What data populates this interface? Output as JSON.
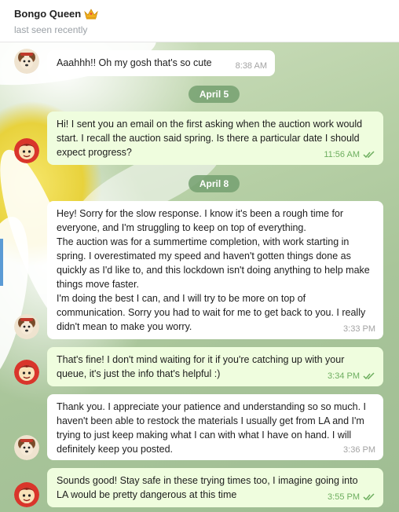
{
  "header": {
    "title": "Bongo Queen",
    "title_icon": "crown-emoji-icon",
    "status": "last seen recently"
  },
  "colors": {
    "incoming_bubble": "#ffffff",
    "outgoing_bubble": "#effdde",
    "date_pill": "#74a070",
    "read_check": "#6dae5f"
  },
  "dates": [
    "April 5",
    "April 8"
  ],
  "messages": [
    {
      "direction": "in",
      "avatar": "dog-avatar-icon",
      "text": "Aaahhh!! Oh my gosh that's so cute",
      "time": "8:38 AM",
      "read": false
    },
    {
      "direction": "out",
      "avatar": "red-character-avatar-icon",
      "text": "Hi! I sent you an email on the first asking when the auction work would start. I recall the auction said spring. Is there a particular date I should expect progress?",
      "time": "11:56 AM",
      "read": true
    },
    {
      "direction": "in",
      "avatar": "dog-avatar-icon",
      "text": "Hey! Sorry for the slow response. I know it's been a rough time for everyone, and I'm struggling to keep on top of everything.\nThe auction was for a summertime completion, with work starting in spring. I overestimated my speed and haven't gotten things done as quickly as I'd like to, and this lockdown isn't doing anything to help make things move faster.\nI'm doing the best I can, and I will try to be more on top of communication. Sorry you had to wait for me to get back to you. I really didn't mean to make you worry.",
      "time": "3:33 PM",
      "read": false
    },
    {
      "direction": "out",
      "avatar": "red-character-avatar-icon",
      "text": "That's fine! I don't mind waiting for it if you're catching up with your queue, it's just the info that's helpful :)",
      "time": "3:34 PM",
      "read": true
    },
    {
      "direction": "in",
      "avatar": "dog-avatar-icon",
      "text": "Thank you. I appreciate your patience and understanding so so much. I haven't been able to restock the materials I usually get from LA and I'm trying to just keep making what I can with what I have on hand. I will definitely keep you posted.",
      "time": "3:36 PM",
      "read": false
    },
    {
      "direction": "out",
      "avatar": "red-character-avatar-icon",
      "text": "Sounds good! Stay safe in these trying times too, I imagine going into LA would be pretty dangerous at this time",
      "time": "3:55 PM",
      "read": true
    }
  ]
}
